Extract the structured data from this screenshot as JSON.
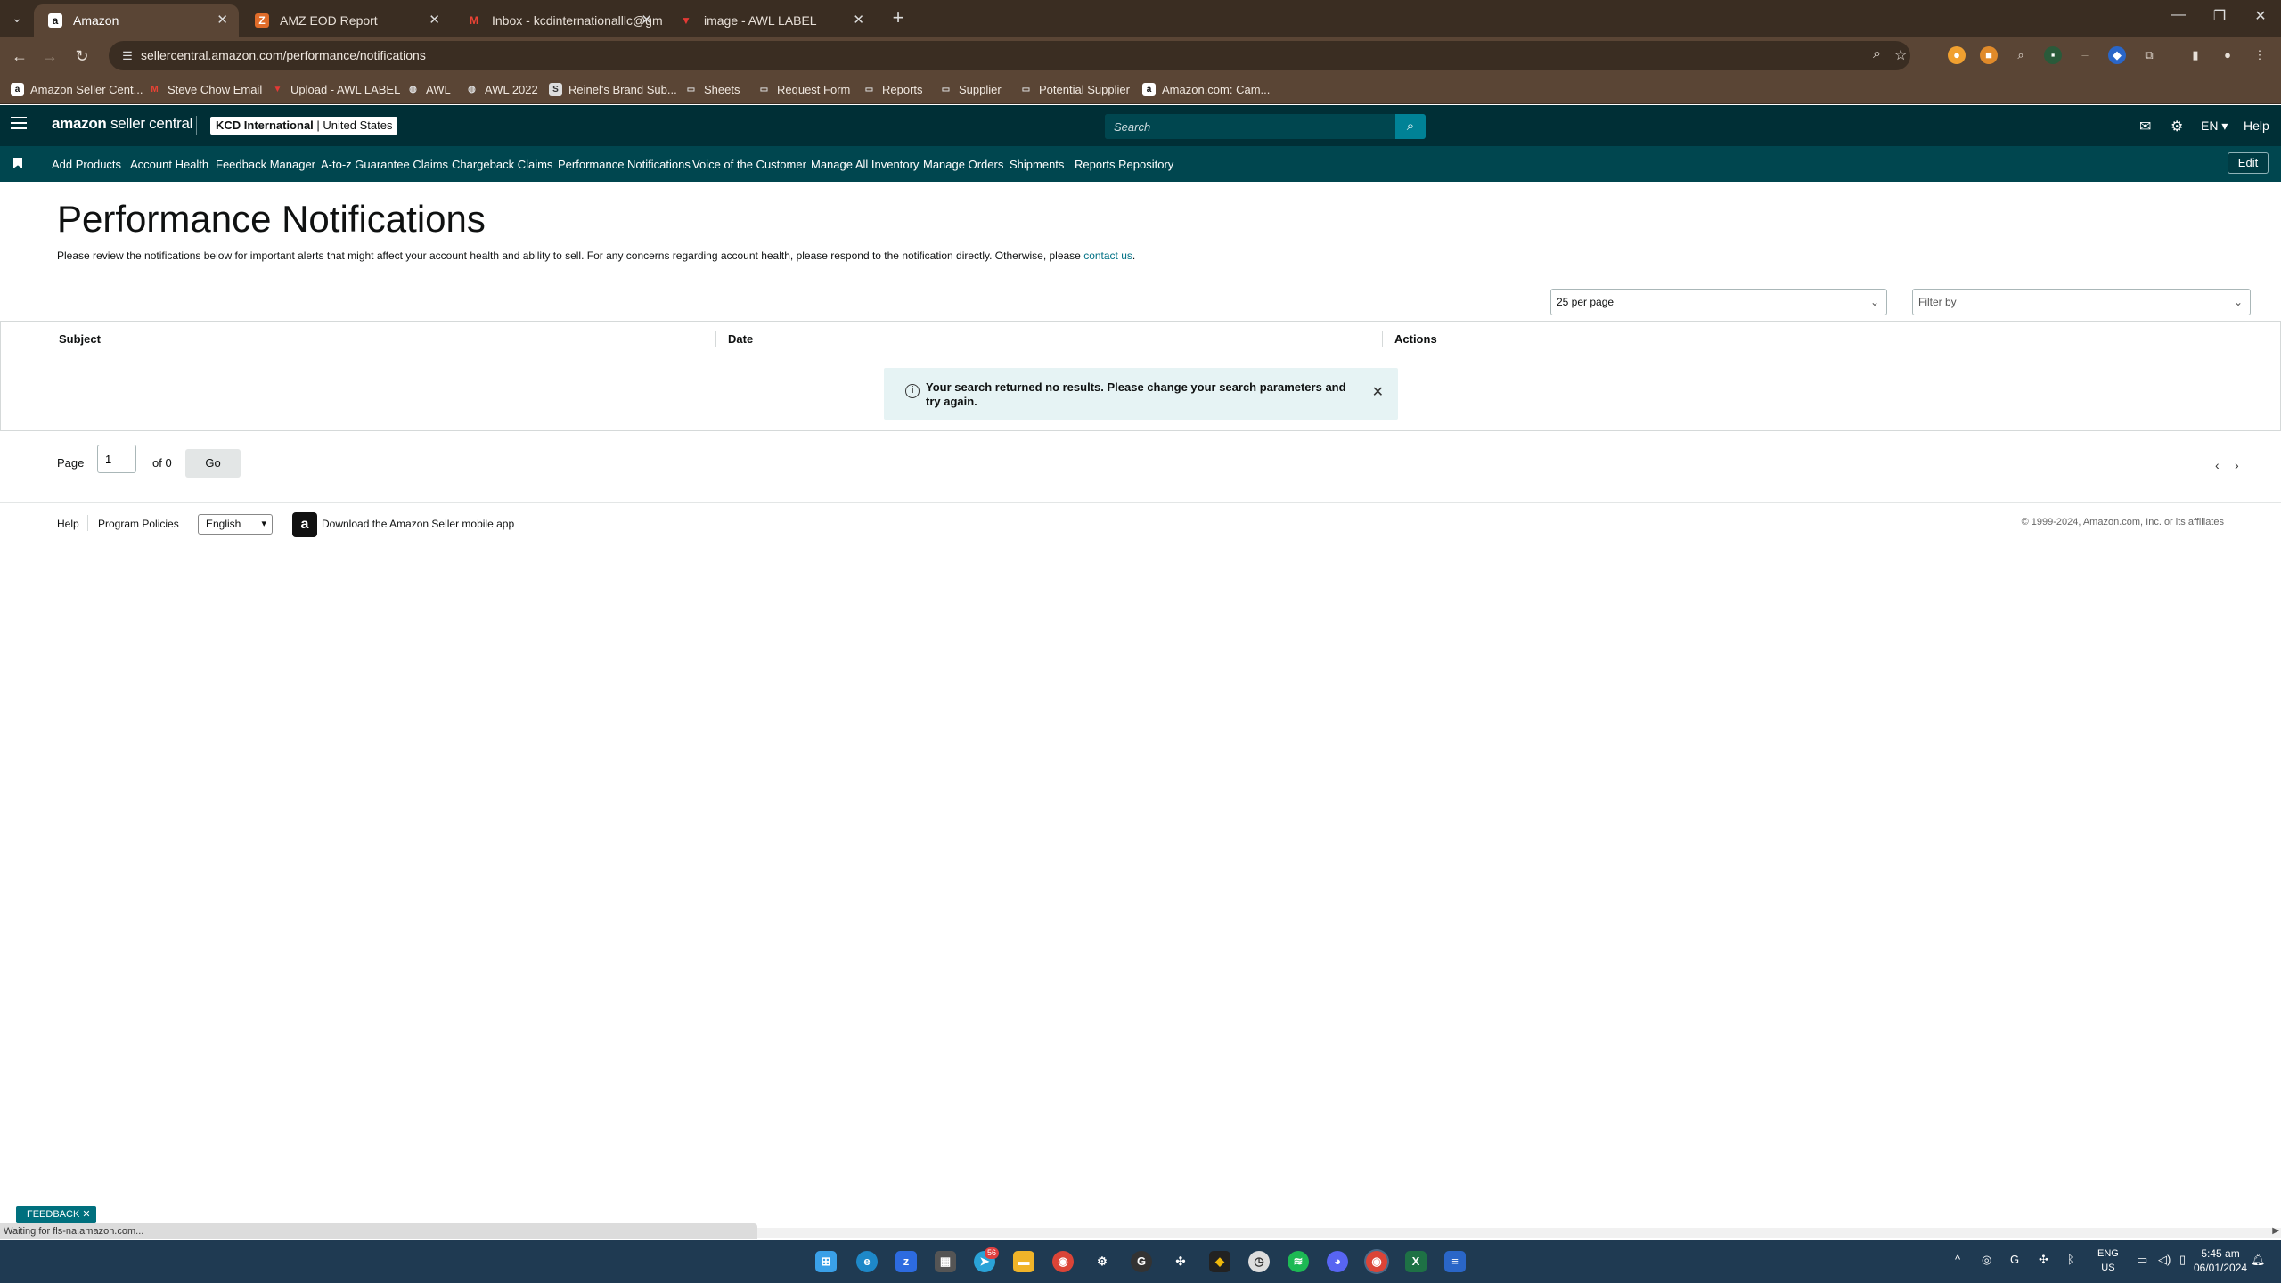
{
  "browser": {
    "tabs": [
      {
        "title": "Amazon",
        "icon": "amazon-icon",
        "active": true
      },
      {
        "title": "AMZ EOD Report",
        "icon": "sheet-icon",
        "active": false
      },
      {
        "title": "Inbox - kcdinternationalllc@gm",
        "icon": "gmail-icon",
        "active": false
      },
      {
        "title": "image - AWL LABEL",
        "icon": "awl-icon",
        "active": false
      }
    ],
    "url": "sellercentral.amazon.com/performance/notifications",
    "bookmarks": [
      "Amazon Seller Cent...",
      "Steve Chow Email",
      "Upload - AWL LABEL",
      "AWL",
      "AWL 2022",
      "Reinel's Brand Sub...",
      "Sheets",
      "Request Form",
      "Reports",
      "Supplier",
      "Potential Supplier",
      "Amazon.com: Cam..."
    ]
  },
  "header": {
    "logo_bold": "amazon",
    "logo_light": "seller central",
    "account_name": "KCD International",
    "account_market": "United States",
    "search_placeholder": "Search",
    "language": "EN",
    "help": "Help"
  },
  "nav": {
    "items": [
      "Add Products",
      "Account Health",
      "Feedback Manager",
      "A-to-z Guarantee Claims",
      "Chargeback Claims",
      "Performance Notifications",
      "Voice of the Customer",
      "Manage All Inventory",
      "Manage Orders",
      "Shipments",
      "Reports Repository"
    ],
    "edit": "Edit"
  },
  "main": {
    "title": "Performance Notifications",
    "description": "Please review the notifications below for important alerts that might affect your account health and ability to sell. For any concerns regarding account health, please respond to the notification directly. Otherwise, please ",
    "contact_link": "contact us",
    "contact_suffix": ".",
    "per_page": "25 per page",
    "filter_placeholder": "Filter by",
    "columns": [
      "Subject",
      "Date",
      "Actions"
    ],
    "alert": "Your search returned no results. Please change your search parameters and try again.",
    "pager": {
      "page_label": "Page",
      "page_value": "1",
      "of_label": "of 0",
      "go": "Go"
    }
  },
  "footer": {
    "help": "Help",
    "program_policies": "Program Policies",
    "language": "English",
    "app_download": "Download the Amazon Seller mobile app",
    "copyright": "© 1999-2024, Amazon.com, Inc. or its affiliates"
  },
  "feedback": "FEEDBACK",
  "status_text": "Waiting for fls-na.amazon.com...",
  "taskbar": {
    "lang_top": "ENG",
    "lang_bottom": "US",
    "time": "5:45 am",
    "date": "06/01/2024",
    "telegram_badge": "56"
  }
}
